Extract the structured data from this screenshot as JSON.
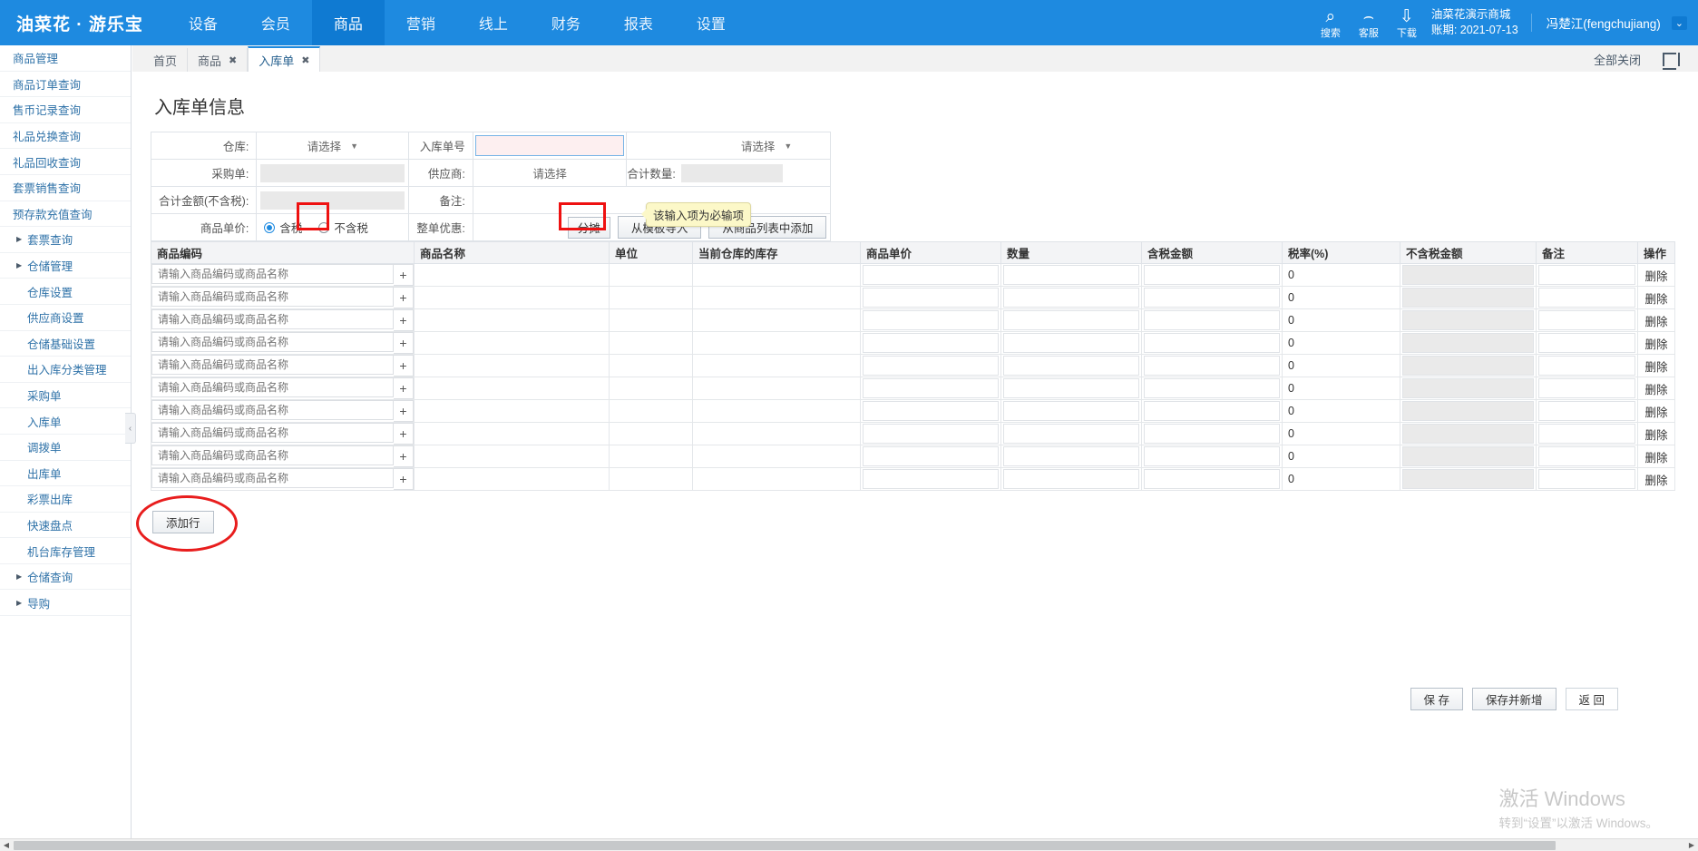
{
  "brand": "油菜花 · 游乐宝",
  "topnav": [
    {
      "label": "设备",
      "active": false
    },
    {
      "label": "会员",
      "active": false
    },
    {
      "label": "商品",
      "active": true
    },
    {
      "label": "营销",
      "active": false
    },
    {
      "label": "线上",
      "active": false
    },
    {
      "label": "财务",
      "active": false
    },
    {
      "label": "报表",
      "active": false
    },
    {
      "label": "设置",
      "active": false
    }
  ],
  "topright": {
    "icons": [
      {
        "name": "search-icon",
        "caption": "搜索",
        "glyph": "⌕"
      },
      {
        "name": "headset-icon",
        "caption": "客服",
        "glyph": "⌢"
      },
      {
        "name": "download-icon",
        "caption": "下载",
        "glyph": "⇩"
      }
    ],
    "shop_name": "油菜花演示商城",
    "account_period": "账期: 2021-07-13",
    "user": "冯楚江(fengchujiang)",
    "caret": "⌄"
  },
  "sidebar": {
    "items": [
      {
        "label": "商品管理",
        "level": 1,
        "group": false
      },
      {
        "label": "商品订单查询",
        "level": 1,
        "group": false
      },
      {
        "label": "售币记录查询",
        "level": 1,
        "group": false
      },
      {
        "label": "礼品兑换查询",
        "level": 1,
        "group": false
      },
      {
        "label": "礼品回收查询",
        "level": 1,
        "group": false
      },
      {
        "label": "套票销售查询",
        "level": 1,
        "group": false
      },
      {
        "label": "预存款充值查询",
        "level": 1,
        "group": false
      },
      {
        "label": "套票查询",
        "level": 1,
        "group": true
      },
      {
        "label": "仓储管理",
        "level": 1,
        "group": true
      },
      {
        "label": "仓库设置",
        "level": 2,
        "group": false
      },
      {
        "label": "供应商设置",
        "level": 2,
        "group": false
      },
      {
        "label": "仓储基础设置",
        "level": 2,
        "group": false
      },
      {
        "label": "出入库分类管理",
        "level": 2,
        "group": false
      },
      {
        "label": "采购单",
        "level": 2,
        "group": false
      },
      {
        "label": "入库单",
        "level": 2,
        "group": false
      },
      {
        "label": "调拨单",
        "level": 2,
        "group": false
      },
      {
        "label": "出库单",
        "level": 2,
        "group": false
      },
      {
        "label": "彩票出库",
        "level": 2,
        "group": false
      },
      {
        "label": "快速盘点",
        "level": 2,
        "group": false
      },
      {
        "label": "机台库存管理",
        "level": 2,
        "group": false
      },
      {
        "label": "仓储查询",
        "level": 1,
        "group": true
      },
      {
        "label": "导购",
        "level": 1,
        "group": true
      }
    ],
    "collapse_glyph": "‹"
  },
  "tabs": [
    {
      "label": "首页",
      "closable": false,
      "active": false
    },
    {
      "label": "商品",
      "closable": true,
      "active": false
    },
    {
      "label": "入库单",
      "closable": true,
      "active": true
    }
  ],
  "tabbar_right": {
    "close_all": "全部关闭",
    "fullscreen_icon": "fullscreen-icon"
  },
  "page": {
    "title": "入库单信息",
    "form": {
      "warehouse_label": "仓库:",
      "warehouse_value": "请选择",
      "receipt_no_label": "入库单号",
      "receipt_no_value": "",
      "type_value": "请选择",
      "purchase_order_label": "采购单:",
      "purchase_order_value": "",
      "supplier_label": "供应商:",
      "supplier_value": "请选择",
      "total_qty_label": "合计数量:",
      "total_qty_value": "",
      "total_amount_label": "合计金额(不含税):",
      "total_amount_value": "",
      "remark_label": "备注:",
      "remark_value": "",
      "unit_price_label": "商品单价:",
      "radio_tax_incl": "含税",
      "radio_tax_excl": "不含税",
      "radio_selected": "含税",
      "whole_discount_label": "整单优惠:",
      "whole_discount_value": "",
      "apportion_button": "分摊",
      "import_template_button": "从模板导入",
      "add_from_list_button": "从商品列表中添加",
      "tooltip": "该输入项为必输项"
    },
    "grid": {
      "columns": [
        "商品编码",
        "商品名称",
        "单位",
        "当前仓库的库存",
        "商品单价",
        "数量",
        "含税金额",
        "税率(%)",
        "不含税金额",
        "备注",
        "操作"
      ],
      "row_placeholder": "请输入商品编码或商品名称",
      "plus_glyph": "+",
      "tax_rate_default": "0",
      "delete_label": "删除",
      "row_count": 10
    },
    "add_row_button": "添加行",
    "footer_buttons": [
      {
        "label": "保 存",
        "style": "default"
      },
      {
        "label": "保存并新增",
        "style": "default"
      },
      {
        "label": "返 回",
        "style": "white"
      }
    ]
  },
  "watermark": {
    "line1": "激活 Windows",
    "line2": "转到“设置”以激活 Windows。"
  },
  "scrollbar": {
    "left_arrow": "◀",
    "right_arrow": "▶"
  },
  "colors": {
    "brand_blue": "#1e8ae0",
    "active_blue": "#0f7ad2",
    "annotation_red": "#ee1111",
    "tooltip_yellow": "#fcf8c8",
    "required_field_pink": "#fdeff0"
  }
}
